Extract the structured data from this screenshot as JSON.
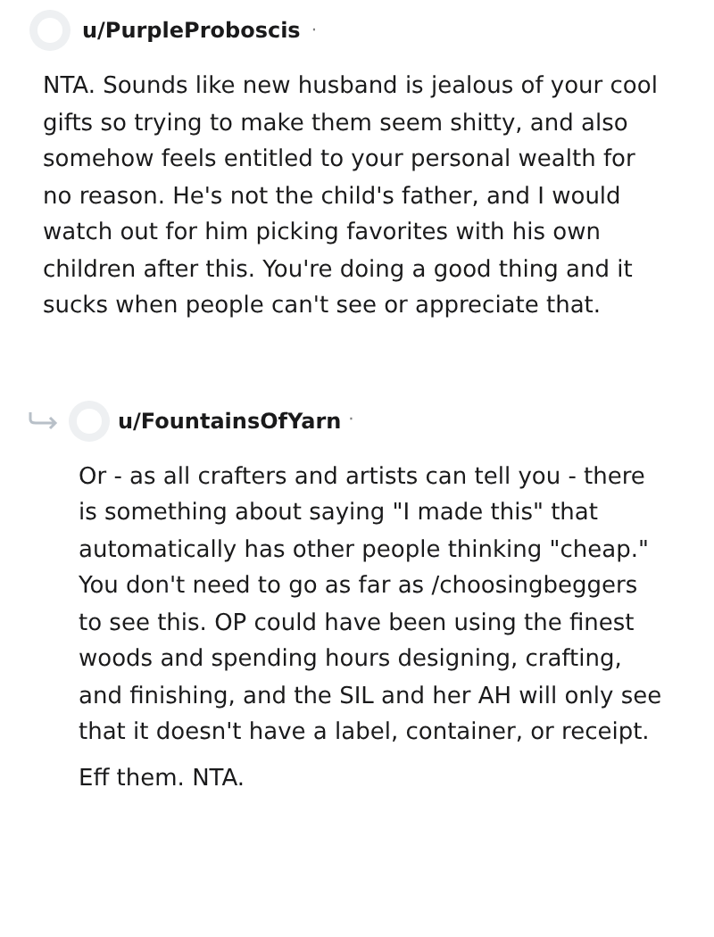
{
  "comments": [
    {
      "username": "u/PurpleProboscis",
      "separator": "·",
      "is_reply": false,
      "paragraphs": [
        "NTA. Sounds like new husband is jealous of your cool gifts so trying to make them seem shitty, and also somehow feels entitled to your personal wealth for no reason. He's not the child's father, and I would watch out for him picking favorites with his own children after this. You're doing a good thing and it sucks when people can't see or appreciate that."
      ]
    },
    {
      "username": "u/FountainsOfYarn",
      "separator": "·",
      "is_reply": true,
      "paragraphs": [
        "Or - as all crafters and artists can tell you - there is something about saying \"I made this\" that automatically has other people thinking \"cheap.\" You don't need to go as far as /choosingbeggers to see this. OP could have been using the finest woods and spending hours designing, crafting, and finishing, and the SIL and her AH will only see that it doesn't have a label, container, or receipt.",
        "Eff them. NTA."
      ]
    }
  ]
}
